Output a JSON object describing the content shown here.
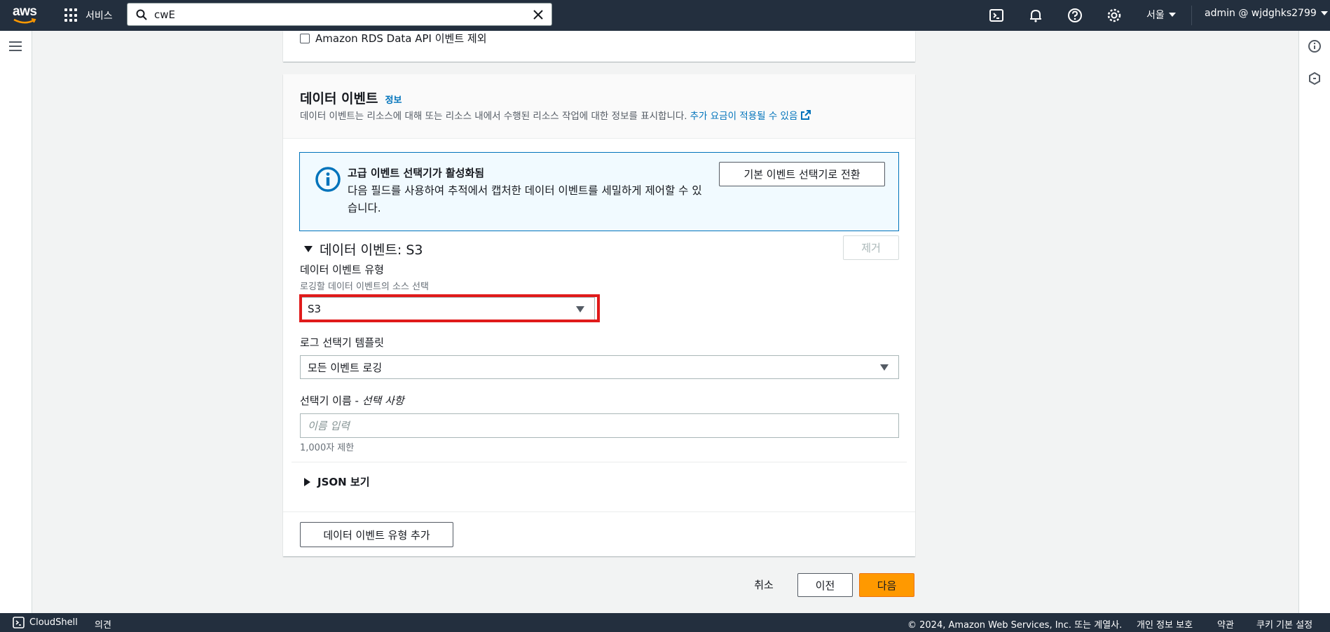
{
  "topnav": {
    "logo_text": "aws",
    "services_label": "서비스",
    "search_value": "cwE",
    "region_label": "서울",
    "account_label": "admin @ wjdghks2799"
  },
  "top_card": {
    "checkbox_label": "Amazon RDS Data API 이벤트 제외"
  },
  "data_events": {
    "title": "데이터 이벤트",
    "info_link": "정보",
    "description": "데이터 이벤트는 리소스에 대해 또는 리소스 내에서 수행된 리소스 작업에 대한 정보를 표시합니다.",
    "charges_link": "추가 요금이 적용될 수 있음",
    "alert": {
      "title": "고급 이벤트 선택기가 활성화됨",
      "body": "다음 필드를 사용하여 추적에서 캡처한 데이터 이벤트를 세밀하게 제어할 수 있습니다.",
      "switch_button": "기본 이벤트 선택기로 전환"
    },
    "section_title": "데이터 이벤트: S3",
    "remove_button": "제거",
    "event_type_label": "데이터 이벤트 유형",
    "event_type_hint": "로깅할 데이터 이벤트의 소스 선택",
    "event_type_value": "S3",
    "template_label": "로그 선택기 템플릿",
    "template_value": "모든 이벤트 로깅",
    "selector_name_label": "선택기 이름 - ",
    "selector_name_optional": "선택 사항",
    "selector_name_placeholder": "이름 입력",
    "selector_name_hint": "1,000자 제한",
    "json_toggle": "JSON 보기",
    "add_type_button": "데이터 이벤트 유형 추가"
  },
  "actions": {
    "cancel": "취소",
    "previous": "이전",
    "next": "다음"
  },
  "bottombar": {
    "cloudshell": "CloudShell",
    "feedback": "의견",
    "copyright": "© 2024, Amazon Web Services, Inc. 또는 계열사.",
    "privacy": "개인 정보 보호",
    "terms": "약관",
    "cookies": "쿠키 기본 설정"
  },
  "colors": {
    "nav_bg": "#232f3e",
    "link": "#0073bb",
    "primary_button": "#ff9900",
    "highlight": "#e01b1b"
  }
}
